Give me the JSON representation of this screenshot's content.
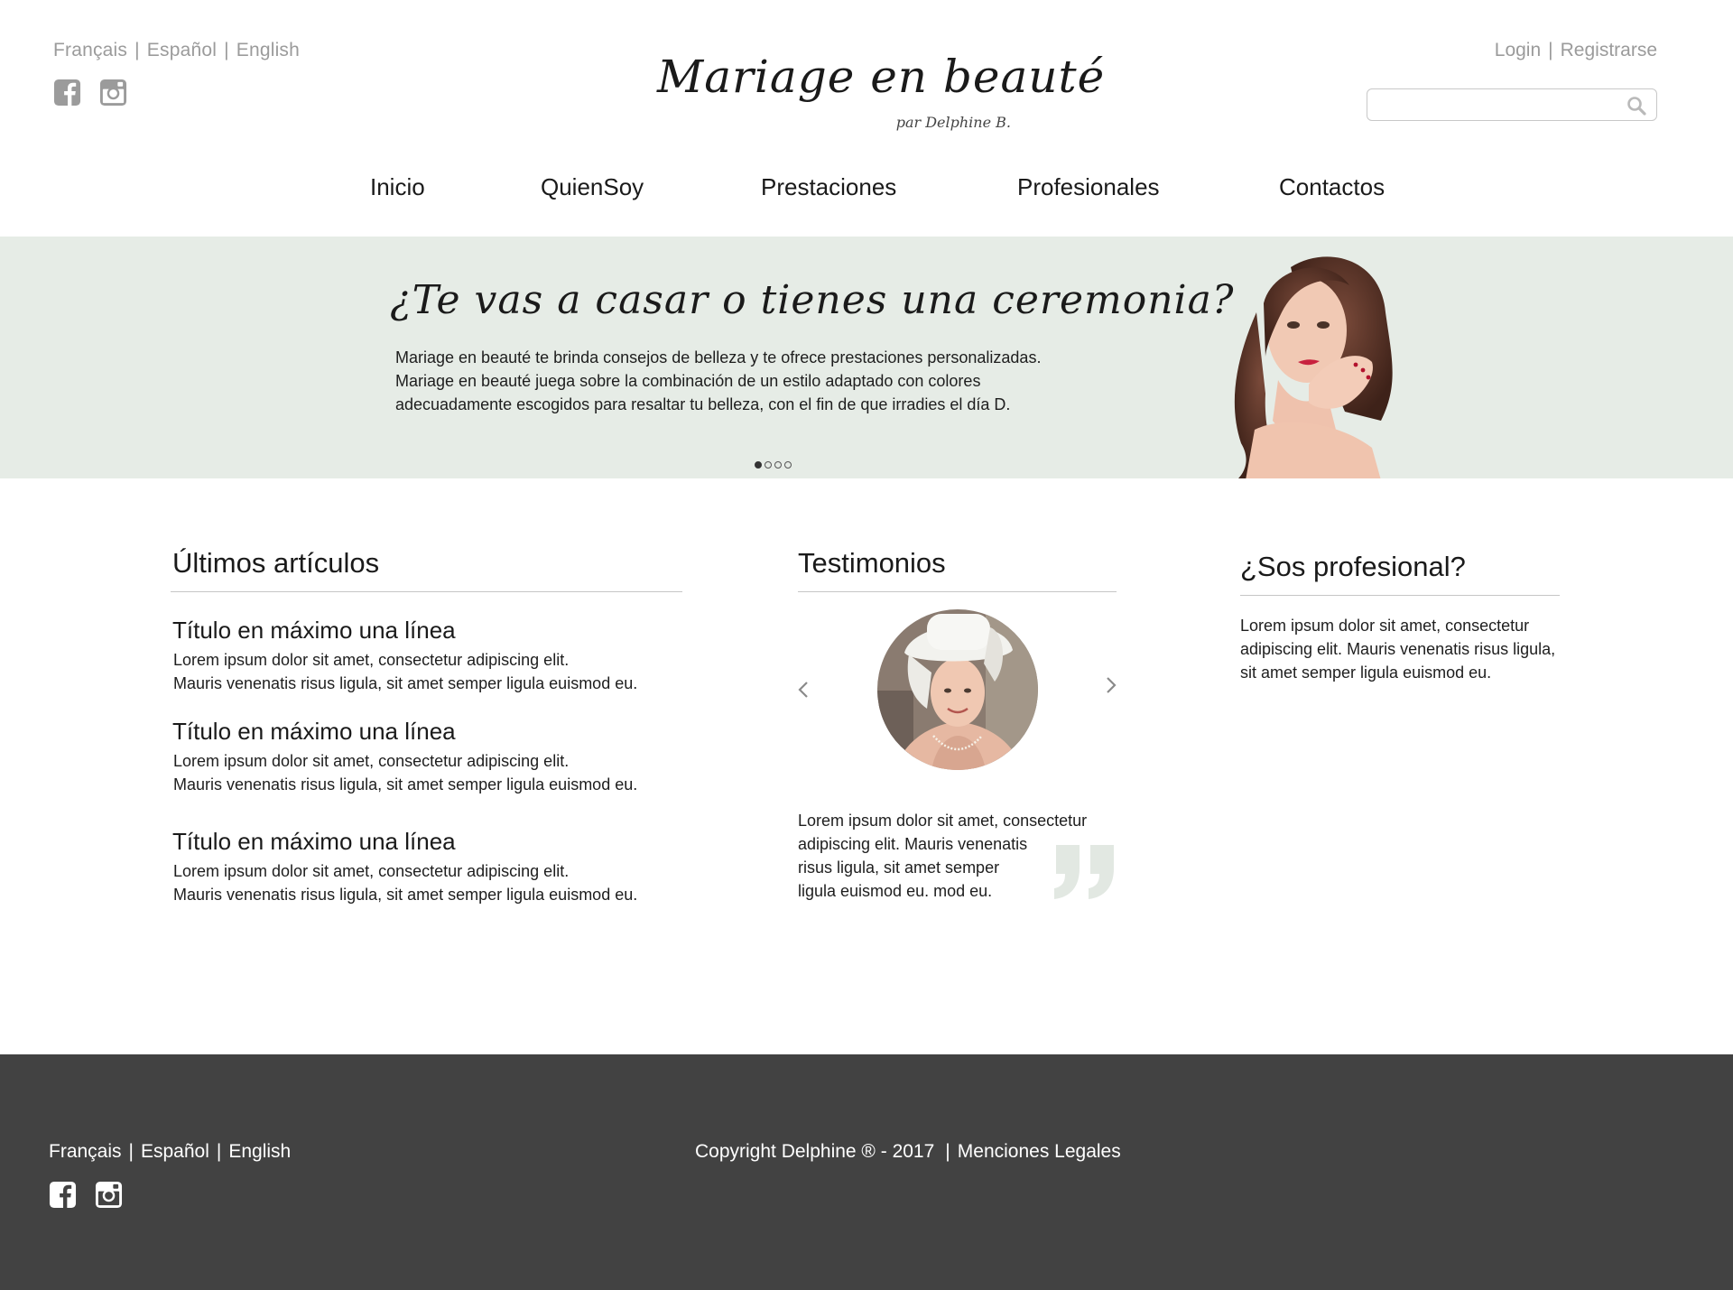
{
  "header": {
    "languages": [
      "Français",
      "Español",
      "English"
    ],
    "separator": "|",
    "social_icons": [
      "facebook-icon",
      "instagram-icon"
    ],
    "logo_title": "Mariage en beauté",
    "logo_subtitle": "par Delphine B.",
    "login_label": "Login",
    "register_label": "Registrarse",
    "search_placeholder": "",
    "search_icon": "search-icon"
  },
  "nav": {
    "items": [
      "Inicio",
      "QuienSoy",
      "Prestaciones",
      "Profesionales",
      "Contactos"
    ]
  },
  "hero": {
    "title": "¿Te vas a casar o tienes una ceremonia?",
    "lines": [
      "Mariage en beauté te brinda consejos de belleza y te ofrece  prestaciones personalizadas.",
      "Mariage en beauté juega sobre la combinación de un estilo adaptado con colores",
      "adecuadamente escogidos para resaltar tu belleza, con el fin de que irradies el día D."
    ],
    "slides_total": 4,
    "active_slide": 1
  },
  "articles": {
    "heading": "Últimos artículos",
    "items": [
      {
        "title": "Título en máximo una línea",
        "line1": "Lorem ipsum dolor sit amet, consectetur adipiscing elit.",
        "line2": "Mauris venenatis risus ligula, sit amet semper ligula euismod eu."
      },
      {
        "title": "Título en máximo una línea",
        "line1": "Lorem ipsum dolor sit amet, consectetur adipiscing elit.",
        "line2": "Mauris venenatis risus ligula, sit amet semper ligula euismod eu."
      },
      {
        "title": "Título en máximo una línea",
        "line1": "Lorem ipsum dolor sit amet, consectetur adipiscing elit.",
        "line2": "Mauris venenatis risus ligula, sit amet semper ligula euismod eu."
      }
    ]
  },
  "testimonials": {
    "heading": "Testimonios",
    "lines": [
      "Lorem ipsum dolor sit amet, consectetur",
      "adipiscing elit. Mauris venenatis",
      "risus ligula, sit amet semper",
      "ligula euismod eu. mod eu."
    ]
  },
  "professional": {
    "heading": "¿Sos profesional?",
    "lines": [
      "Lorem ipsum dolor sit amet, consectetur",
      "adipiscing elit. Mauris venenatis risus ligula,",
      "sit amet semper ligula euismod eu."
    ]
  },
  "footer": {
    "languages": [
      "Français",
      "Español",
      "English"
    ],
    "copyright": "Copyright Delphine ® - 2017",
    "legal_label": "Menciones Legales"
  },
  "colors": {
    "hero_bg": "#e6ece6",
    "footer_bg": "#424242",
    "muted_text": "#9b9b9b",
    "rule": "#c6c6c6"
  }
}
